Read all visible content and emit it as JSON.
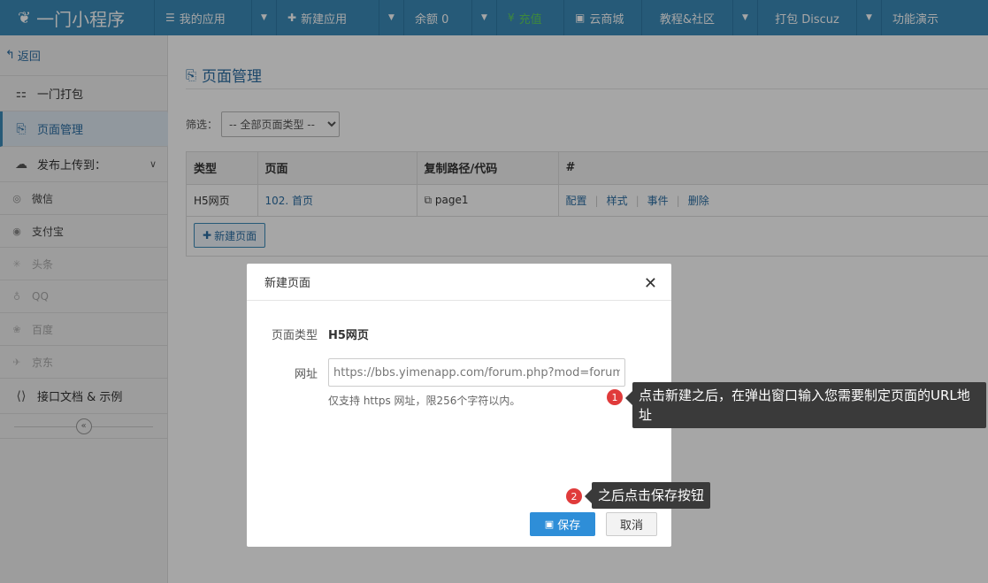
{
  "brand": {
    "logo_icon": "leaf-icon",
    "name": "一门小程序"
  },
  "nav": {
    "my_apps": "我的应用",
    "new_app": "新建应用",
    "balance": "余额 0",
    "recharge": "充值",
    "cloud_store": "云商城",
    "tutorial": "教程&社区",
    "pack_discuz": "打包 Discuz",
    "demo": "功能演示"
  },
  "sidebar": {
    "back": "返回",
    "one_pack": "一门打包",
    "page_manage": "页面管理",
    "publish": "发布上传到：",
    "platforms": [
      "微信",
      "支付宝",
      "头条",
      "QQ",
      "百度",
      "京东"
    ],
    "api_docs": "接口文档 & 示例"
  },
  "main": {
    "title": "页面管理",
    "filter_label": "筛选：",
    "filter_value": "-- 全部页面类型 --",
    "table": {
      "headers": [
        "类型",
        "页面",
        "复制路径/代码",
        "#"
      ],
      "rows": [
        {
          "type": "H5网页",
          "page": "102. 首页",
          "path": "page1",
          "ops": [
            "配置",
            "样式",
            "事件",
            "删除"
          ]
        }
      ]
    },
    "new_page_button": "新建页面"
  },
  "modal": {
    "title": "新建页面",
    "type_label": "页面类型",
    "type_value": "H5网页",
    "url_label": "网址",
    "url_value": "https://bbs.yimenapp.com/forum.php?mod=forum",
    "help": "仅支持 https 网址，限256个字符以内。",
    "save": "保存",
    "cancel": "取消"
  },
  "tips": {
    "one_num": "1",
    "one_text": "点击新建之后，在弹出窗口输入您需要制定页面的URL地址",
    "two_num": "2",
    "two_text": "之后点击保存按钮"
  },
  "colors": {
    "nav_bg": "#3b8ab8",
    "link": "#2b6ea3",
    "save": "#2e8ed8",
    "badge": "#e03b3b"
  }
}
